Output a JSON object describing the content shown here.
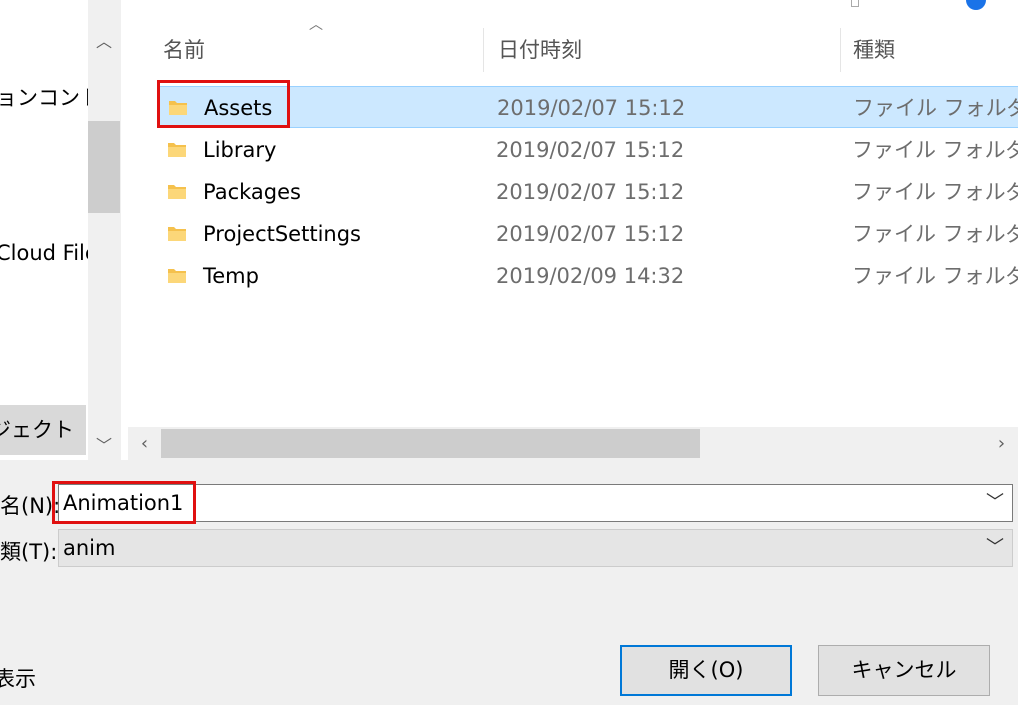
{
  "nav": {
    "items": [
      {
        "label": "ョンコントロ"
      },
      {
        "label": "Cloud Files"
      },
      {
        "label": "ジェクト"
      }
    ]
  },
  "columns": {
    "name": "名前",
    "date": "日付時刻",
    "type": "種類"
  },
  "files": [
    {
      "name": "Assets",
      "date": "2019/02/07 15:12",
      "type": "ファイル フォルダー",
      "selected": true
    },
    {
      "name": "Library",
      "date": "2019/02/07 15:12",
      "type": "ファイル フォルダー"
    },
    {
      "name": "Packages",
      "date": "2019/02/07 15:12",
      "type": "ファイル フォルダー"
    },
    {
      "name": "ProjectSettings",
      "date": "2019/02/07 15:12",
      "type": "ファイル フォルダー"
    },
    {
      "name": "Temp",
      "date": "2019/02/09 14:32",
      "type": "ファイル フォルダー"
    }
  ],
  "filename": {
    "label": "名(N):",
    "value": "Animation1"
  },
  "filetype": {
    "label": "類(T):",
    "value": "anim"
  },
  "footer": {
    "hide_folders_label": "表示"
  },
  "buttons": {
    "open": "開く(O)",
    "cancel": "キャンセル"
  },
  "colors": {
    "selection_bg": "#cce8ff",
    "selection_border": "#99d1ff",
    "highlight": "#e01010",
    "default_button_border": "#0078d7",
    "folder": "#f5c14d"
  }
}
